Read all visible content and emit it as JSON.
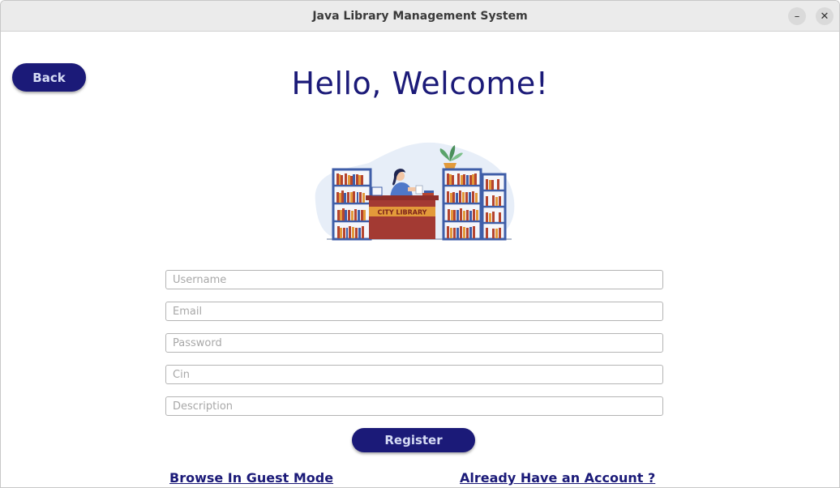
{
  "window": {
    "title": "Java Library Management System",
    "minimize_glyph": "–",
    "close_glyph": "✕"
  },
  "back_button": {
    "label": "Back"
  },
  "heading": "Hello, Welcome!",
  "illustration": {
    "name": "library-desk-illustration",
    "sign_text": "CITY LIBRARY"
  },
  "form": {
    "username": {
      "placeholder": "Username",
      "value": ""
    },
    "email": {
      "placeholder": "Email",
      "value": ""
    },
    "password": {
      "placeholder": "Password",
      "value": ""
    },
    "cin": {
      "placeholder": "Cin",
      "value": ""
    },
    "description": {
      "placeholder": "Description",
      "value": ""
    }
  },
  "register_button": {
    "label": "Register"
  },
  "links": {
    "guest": "Browse In Guest Mode",
    "login": "Already Have an Account ?"
  },
  "colors": {
    "primary": "#1b1a78",
    "button_text": "#d6dcf5",
    "desk": "#a33a33",
    "shelf": "#3f5ea8"
  }
}
